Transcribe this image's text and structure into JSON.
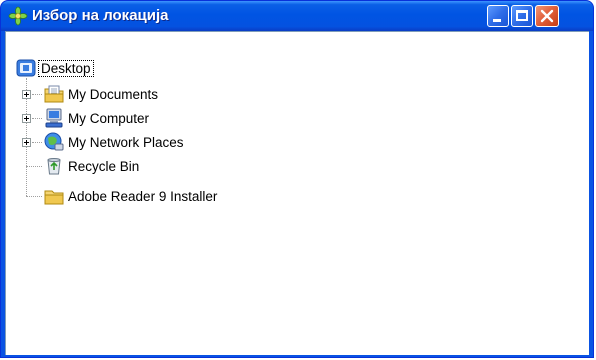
{
  "window": {
    "title": "Избор на локација"
  },
  "tree": {
    "root": {
      "label": "Desktop",
      "icon": "desktop-icon"
    },
    "items": [
      {
        "label": "My Documents",
        "icon": "my-documents-icon",
        "expandable": true
      },
      {
        "label": "My Computer",
        "icon": "my-computer-icon",
        "expandable": true
      },
      {
        "label": "My Network Places",
        "icon": "network-places-icon",
        "expandable": true
      },
      {
        "label": "Recycle Bin",
        "icon": "recycle-bin-icon",
        "expandable": false
      },
      {
        "label": "Adobe Reader 9 Installer",
        "icon": "folder-icon",
        "expandable": false
      }
    ]
  },
  "colors": {
    "titlebar": "#0054e3",
    "close_button": "#e2623d",
    "client_background": "#ffffff"
  }
}
